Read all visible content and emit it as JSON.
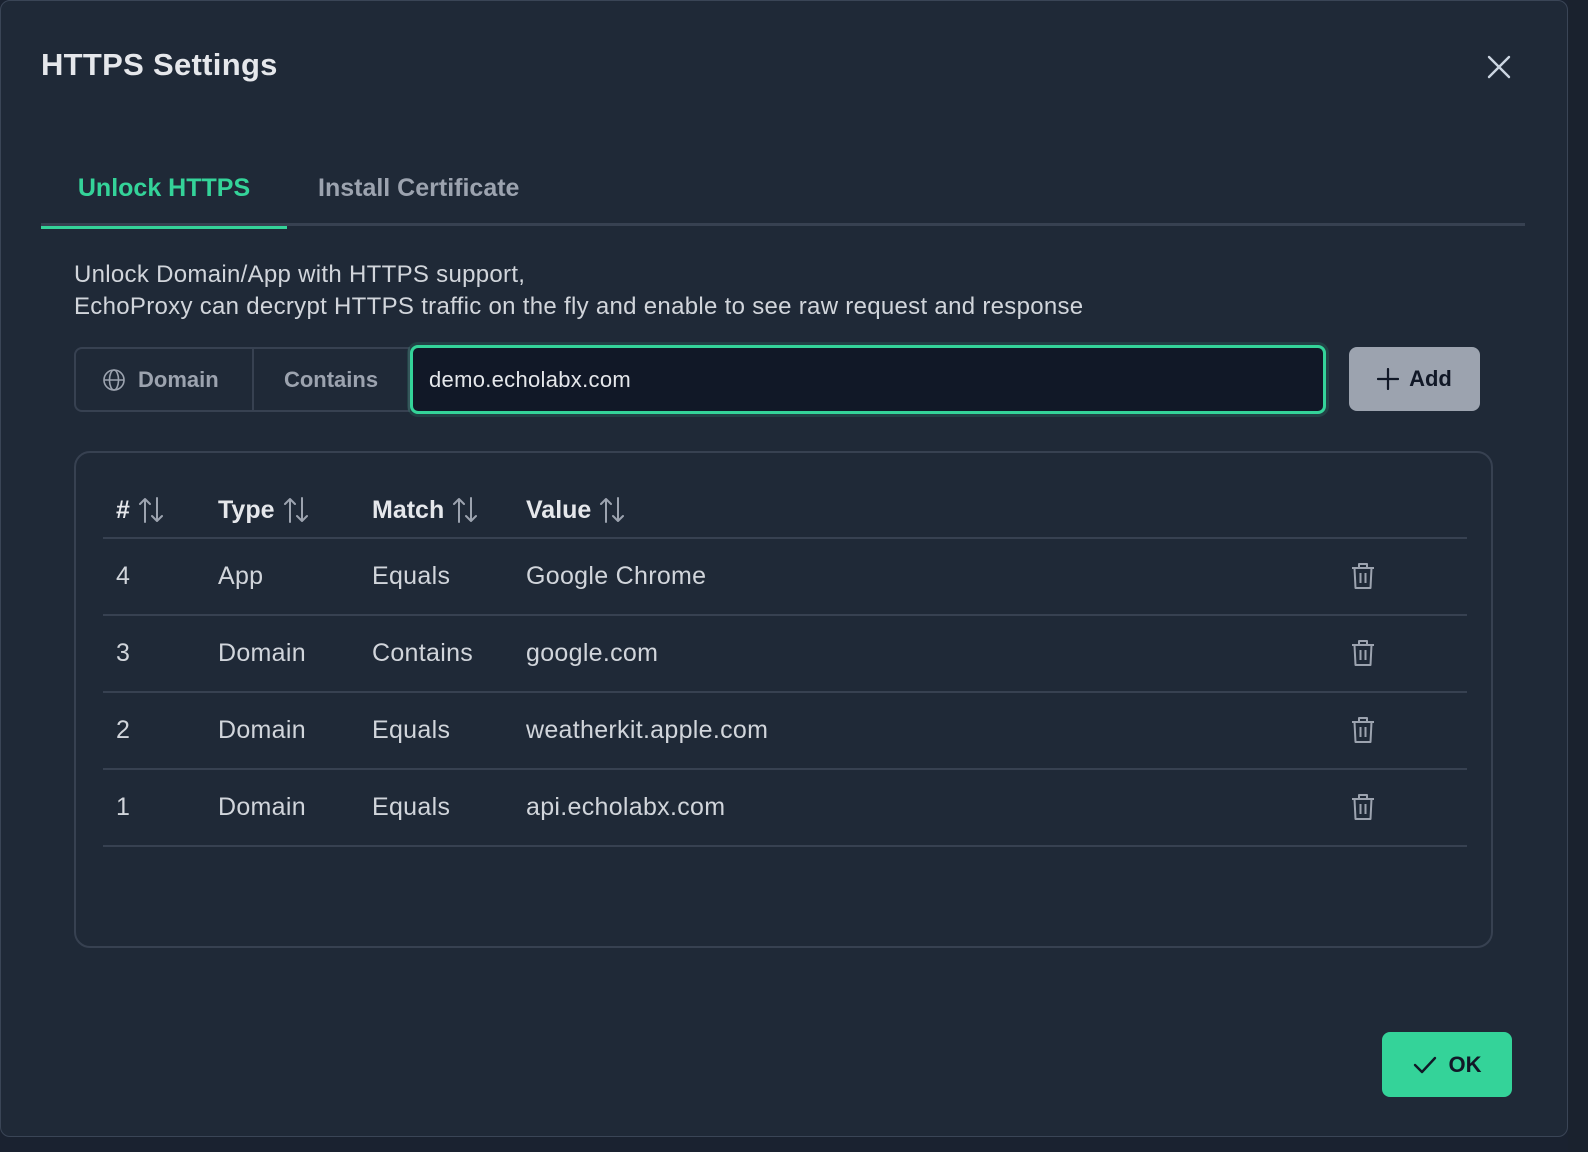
{
  "dialog": {
    "title": "HTTPS Settings",
    "close_icon": "close-icon"
  },
  "tabs": [
    {
      "label": "Unlock HTTPS",
      "active": true
    },
    {
      "label": "Install Certificate",
      "active": false
    }
  ],
  "description": {
    "line1": "Unlock Domain/App with HTTPS support,",
    "line2": "EchoProxy can decrypt HTTPS traffic on the fly and enable to see raw request and response"
  },
  "filter": {
    "type_label": "Domain",
    "type_icon": "globe-icon",
    "match_label": "Contains",
    "input_value": "demo.echolabx.com",
    "add_label": "Add",
    "add_icon": "plus-icon"
  },
  "table": {
    "columns": [
      {
        "label": "#"
      },
      {
        "label": "Type"
      },
      {
        "label": "Match"
      },
      {
        "label": "Value"
      }
    ],
    "rows": [
      {
        "id": "4",
        "type": "App",
        "match": "Equals",
        "value": "Google Chrome"
      },
      {
        "id": "3",
        "type": "Domain",
        "match": "Contains",
        "value": "google.com"
      },
      {
        "id": "2",
        "type": "Domain",
        "match": "Equals",
        "value": "weatherkit.apple.com"
      },
      {
        "id": "1",
        "type": "Domain",
        "match": "Equals",
        "value": "api.echolabx.com"
      }
    ]
  },
  "footer": {
    "ok_label": "OK",
    "ok_icon": "check-icon"
  },
  "colors": {
    "accent": "#34d399",
    "background": "#1f2937",
    "border": "#374151"
  }
}
